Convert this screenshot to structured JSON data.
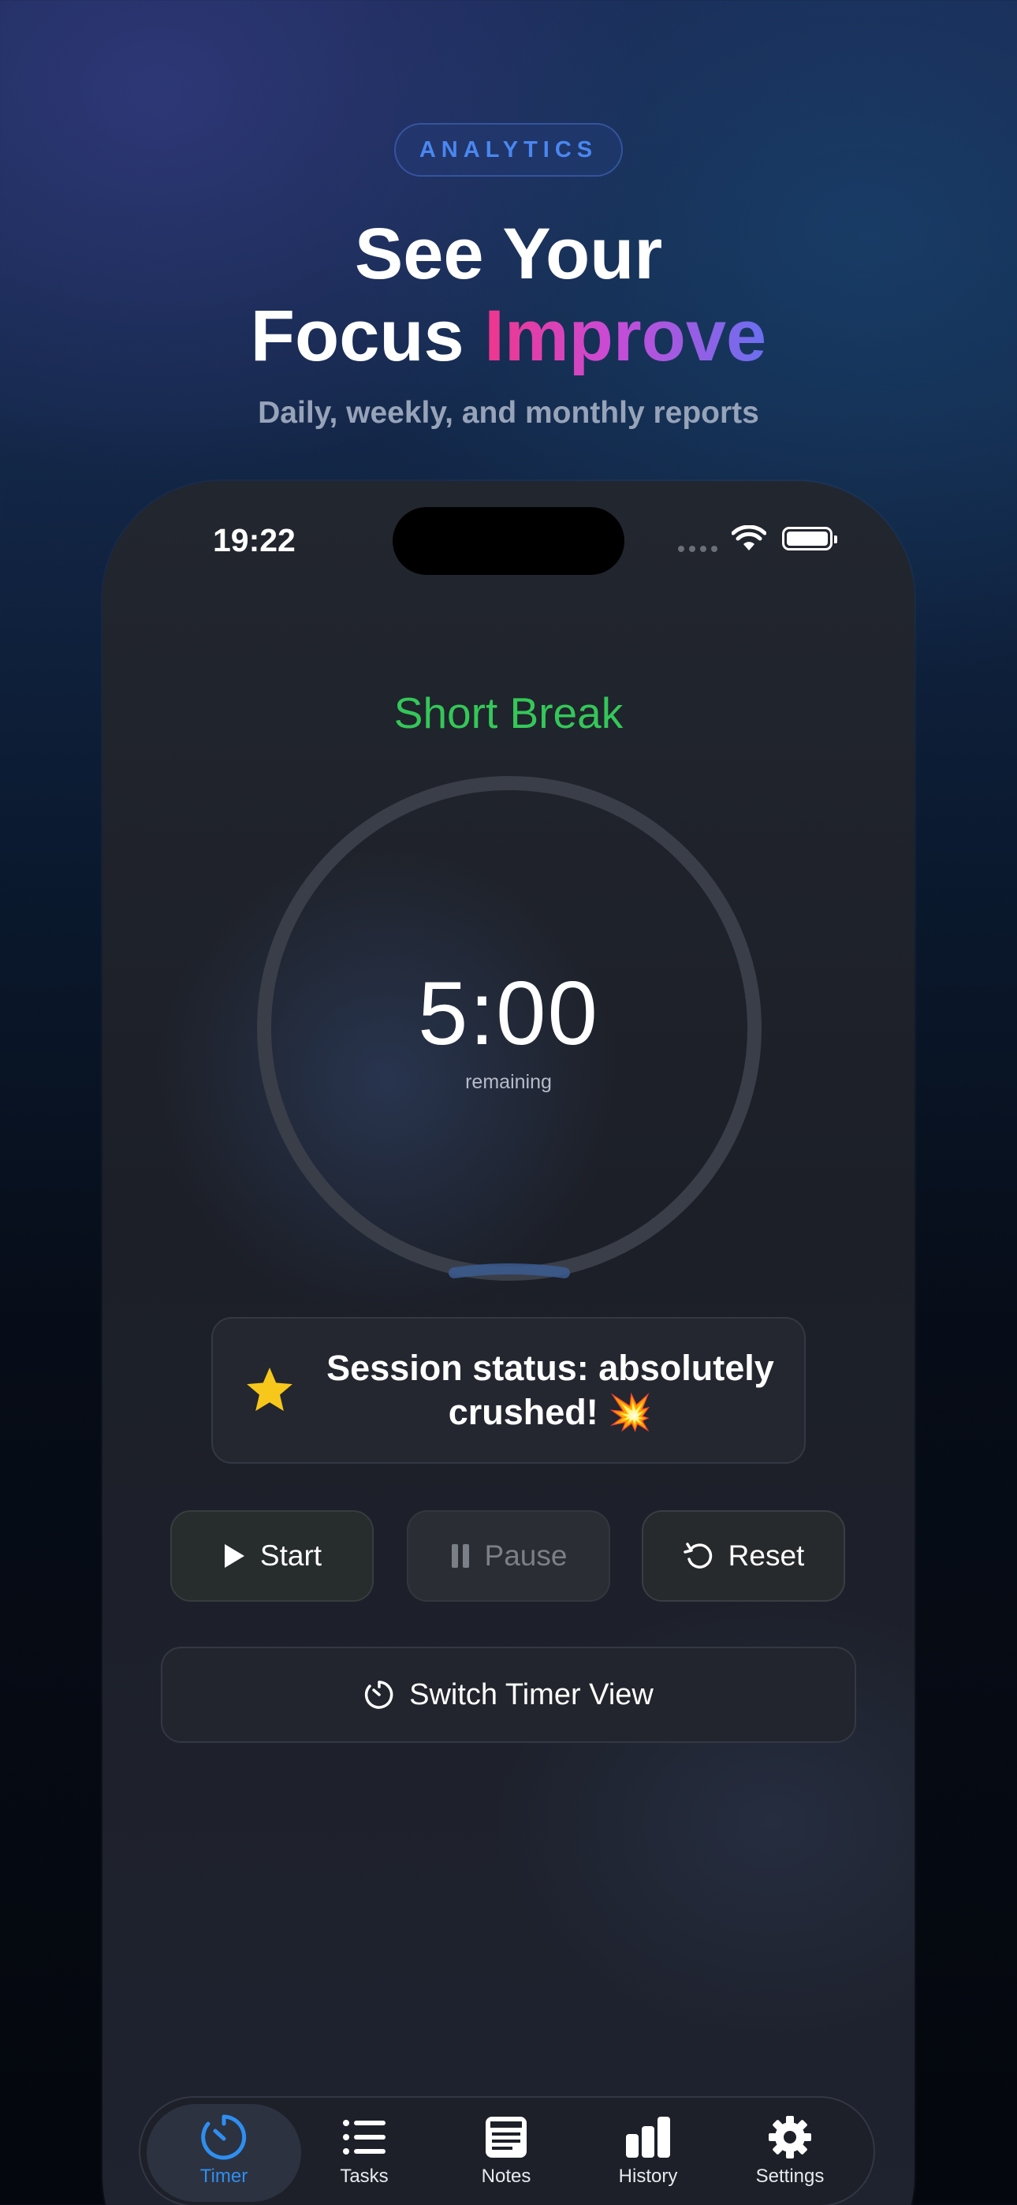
{
  "promo": {
    "badge": "ANALYTICS",
    "headline_line1": "See Your",
    "headline_line2_plain": "Focus ",
    "headline_line2_accent": "Improve",
    "subtitle": "Daily, weekly, and monthly reports"
  },
  "status_bar": {
    "time": "19:22"
  },
  "timer": {
    "mode": "Short Break",
    "mode_color": "#34c759",
    "time_remaining": "5:00",
    "remaining_label": "remaining",
    "progress": 0.0
  },
  "status_card": {
    "icon": "star-icon",
    "text": "Session status: absolutely crushed! 💥"
  },
  "controls": {
    "start_label": "Start",
    "pause_label": "Pause",
    "reset_label": "Reset"
  },
  "switch_view": {
    "label": "Switch Timer View"
  },
  "tabbar": {
    "items": [
      {
        "label": "Timer",
        "icon": "timer-icon",
        "active": true
      },
      {
        "label": "Tasks",
        "icon": "list-icon",
        "active": false
      },
      {
        "label": "Notes",
        "icon": "note-icon",
        "active": false
      },
      {
        "label": "History",
        "icon": "bar-chart-icon",
        "active": false
      },
      {
        "label": "Settings",
        "icon": "gear-icon",
        "active": false
      }
    ],
    "accent": "#2f8ef0"
  }
}
